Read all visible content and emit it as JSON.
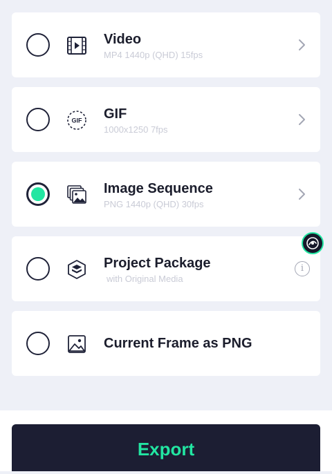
{
  "options": [
    {
      "title": "Video",
      "subtitle": "MP4 1440p (QHD) 15fps",
      "icon": "video-icon",
      "selected": false,
      "trailing": "chevron"
    },
    {
      "title": "GIF",
      "subtitle": "1000x1250 7fps",
      "icon": "gif-icon",
      "selected": false,
      "trailing": "chevron"
    },
    {
      "title": "Image Sequence",
      "subtitle": "PNG 1440p (QHD) 30fps",
      "icon": "image-sequence-icon",
      "selected": true,
      "trailing": "chevron"
    },
    {
      "title": "Project Package",
      "subtitle": "with Original Media",
      "icon": "package-layers-icon",
      "selected": false,
      "trailing": "info"
    },
    {
      "title": "Current Frame as PNG",
      "subtitle": "",
      "icon": "image-icon",
      "selected": false,
      "trailing": "none"
    }
  ],
  "info_glyph": "i",
  "export_label": "Export",
  "floating_badge_icon": "app-logo-icon",
  "colors": {
    "accent": "#22e6a2",
    "dark": "#1c1e33",
    "background": "#eef0f7",
    "card": "#ffffff",
    "subtitle": "#c9cbd6"
  }
}
